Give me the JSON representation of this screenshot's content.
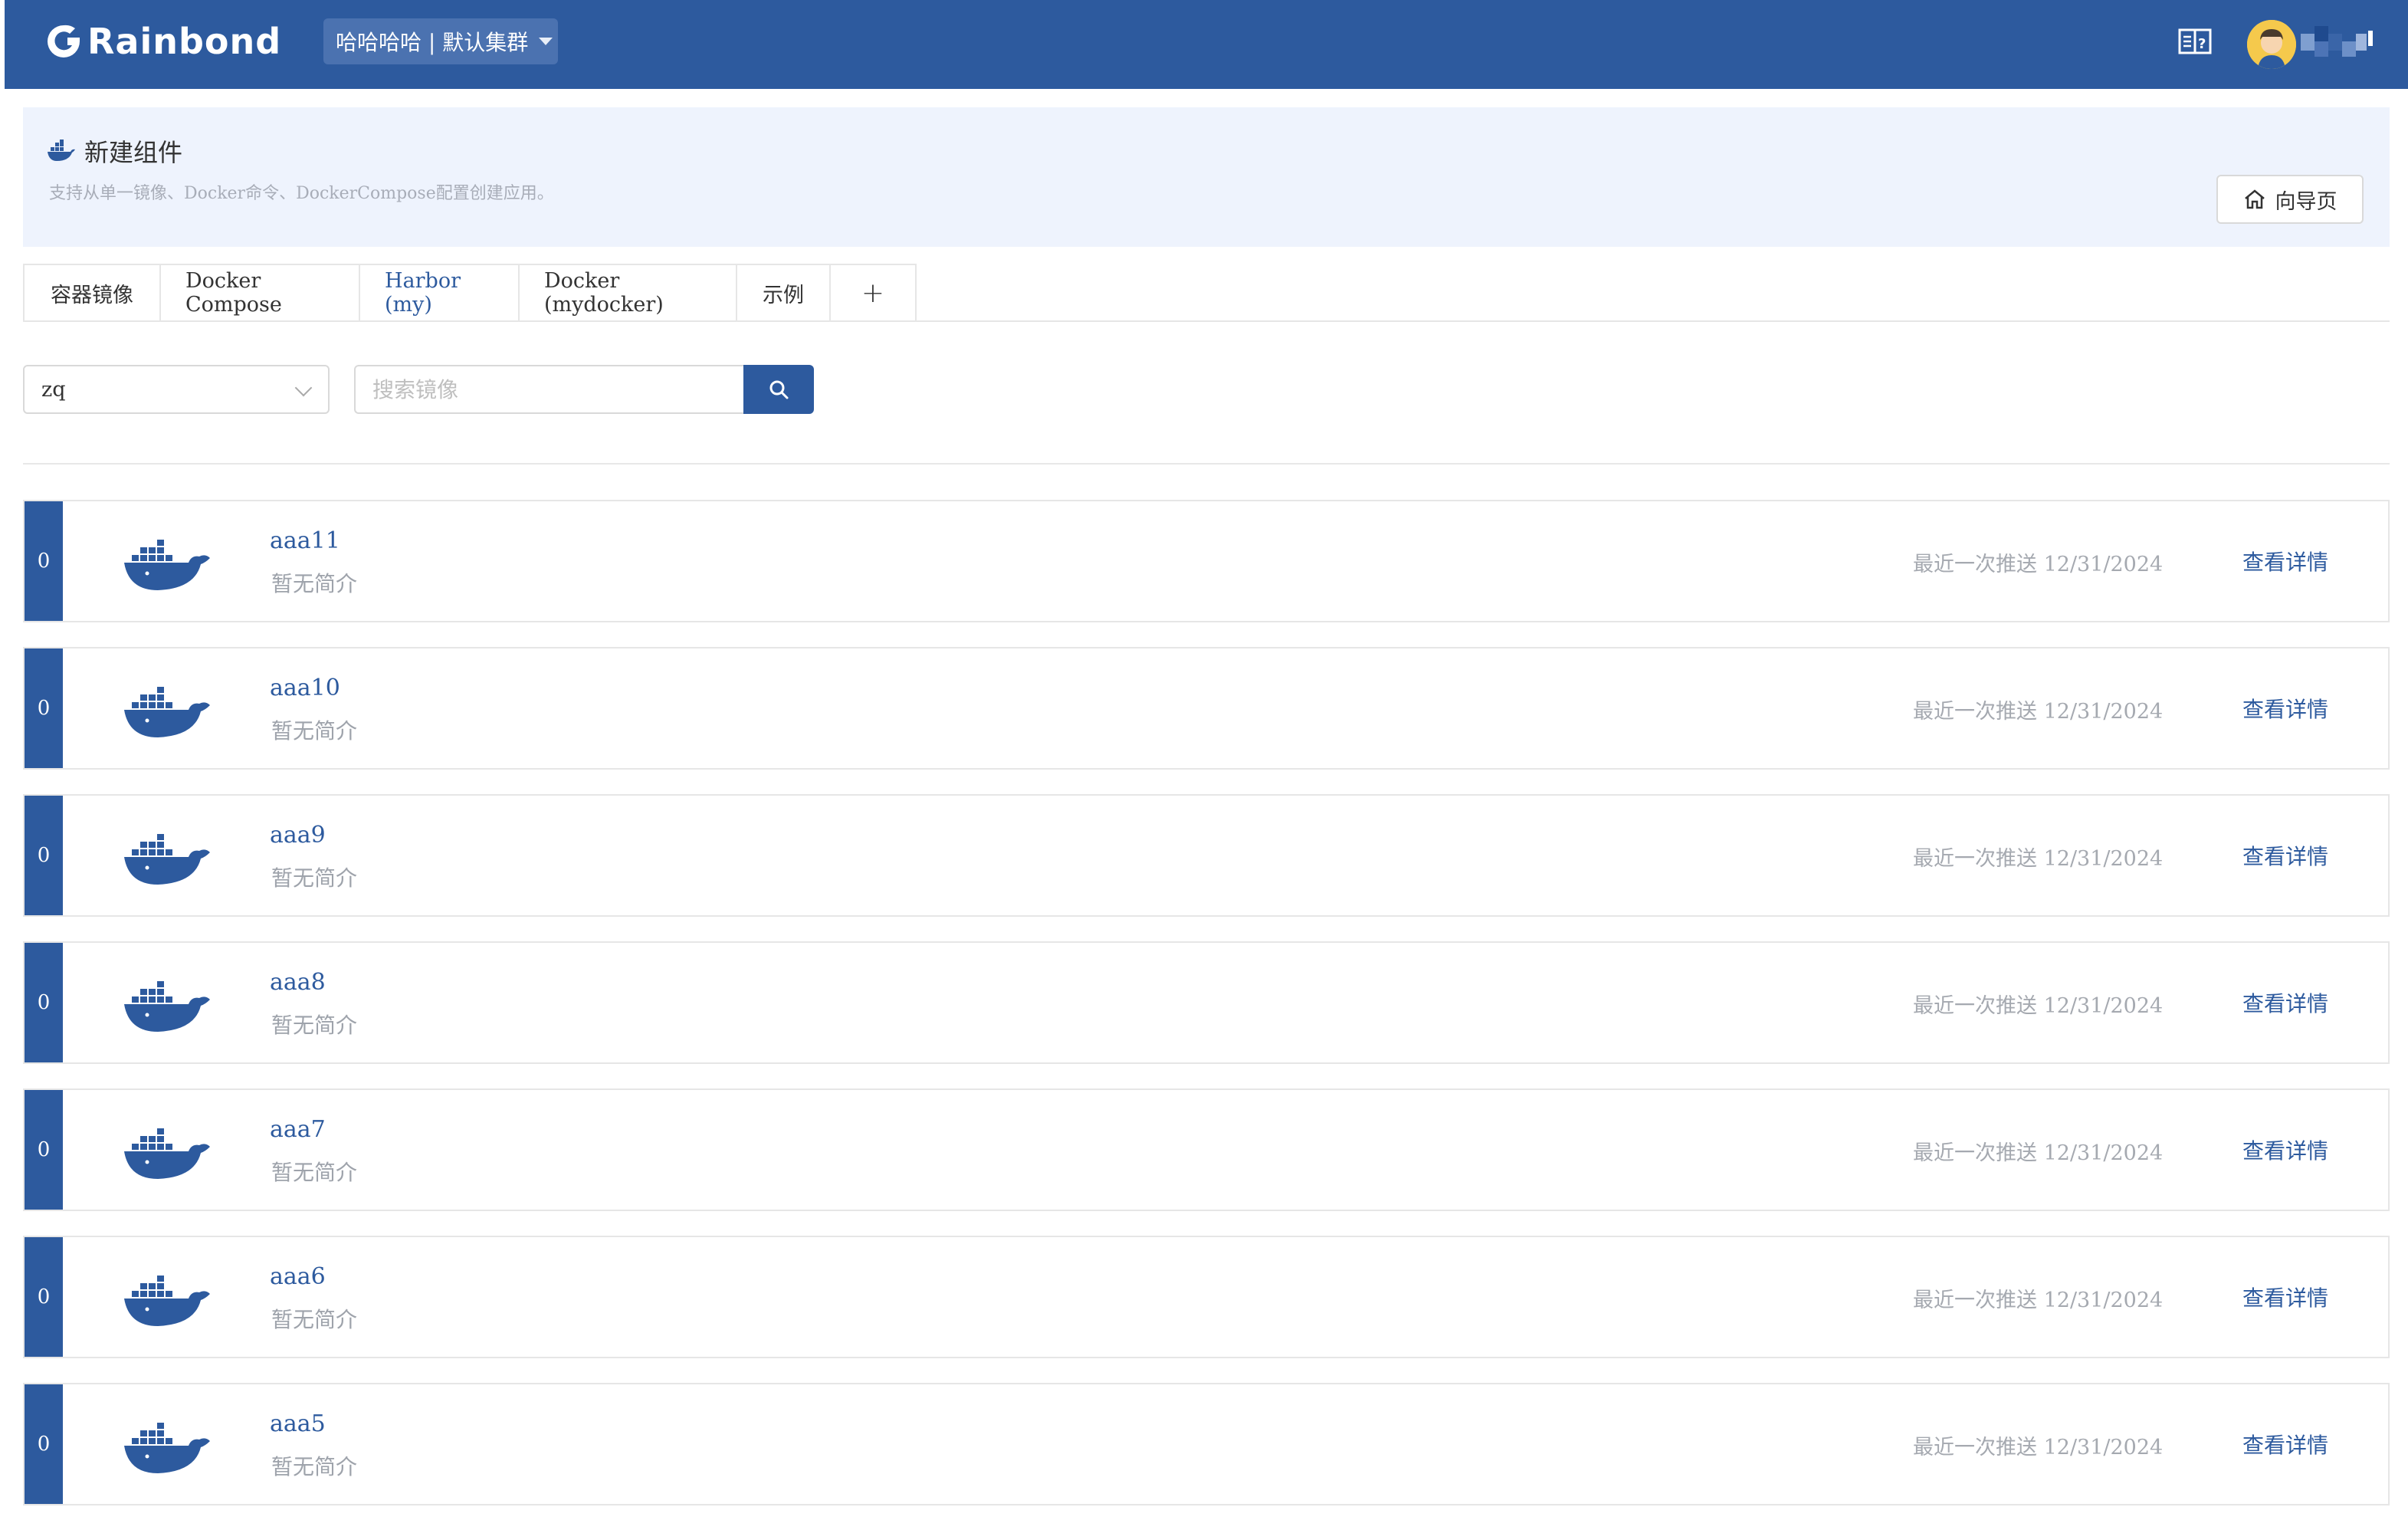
{
  "nav": {
    "brand": "Rainbond",
    "team_selector": "哈哈哈哈 | 默认集群",
    "doc_icon": "book-icon",
    "avatar_icon": "user-avatar"
  },
  "header": {
    "title": "新建组件",
    "description": "支持从单一镜像、Docker命令、DockerCompose配置创建应用。",
    "guide_button": "向导页"
  },
  "tabs": [
    {
      "label": "容器镜像"
    },
    {
      "label": "Docker Compose"
    },
    {
      "label": "Harbor (my)"
    },
    {
      "label": "Docker (mydocker)"
    },
    {
      "label": "示例"
    },
    {
      "label": "+"
    }
  ],
  "active_tab": "Harbor (my)",
  "search": {
    "repo_value": "zq",
    "placeholder": "搜索镜像"
  },
  "images": [
    {
      "index": "0",
      "name": "aaa11",
      "desc": "暂无简介",
      "time": "最近一次推送 12/31/2024",
      "action": "查看详情"
    },
    {
      "index": "0",
      "name": "aaa10",
      "desc": "暂无简介",
      "time": "最近一次推送 12/31/2024",
      "action": "查看详情"
    },
    {
      "index": "0",
      "name": "aaa9",
      "desc": "暂无简介",
      "time": "最近一次推送 12/31/2024",
      "action": "查看详情"
    },
    {
      "index": "0",
      "name": "aaa8",
      "desc": "暂无简介",
      "time": "最近一次推送 12/31/2024",
      "action": "查看详情"
    },
    {
      "index": "0",
      "name": "aaa7",
      "desc": "暂无简介",
      "time": "最近一次推送 12/31/2024",
      "action": "查看详情"
    },
    {
      "index": "0",
      "name": "aaa6",
      "desc": "暂无简介",
      "time": "最近一次推送 12/31/2024",
      "action": "查看详情"
    },
    {
      "index": "0",
      "name": "aaa5",
      "desc": "暂无简介",
      "time": "最近一次推送 12/31/2024",
      "action": "查看详情"
    }
  ],
  "colors": {
    "primary": "#2d5a9e",
    "header_bg": "#eef3fd",
    "muted_text": "#a5a9b0"
  }
}
